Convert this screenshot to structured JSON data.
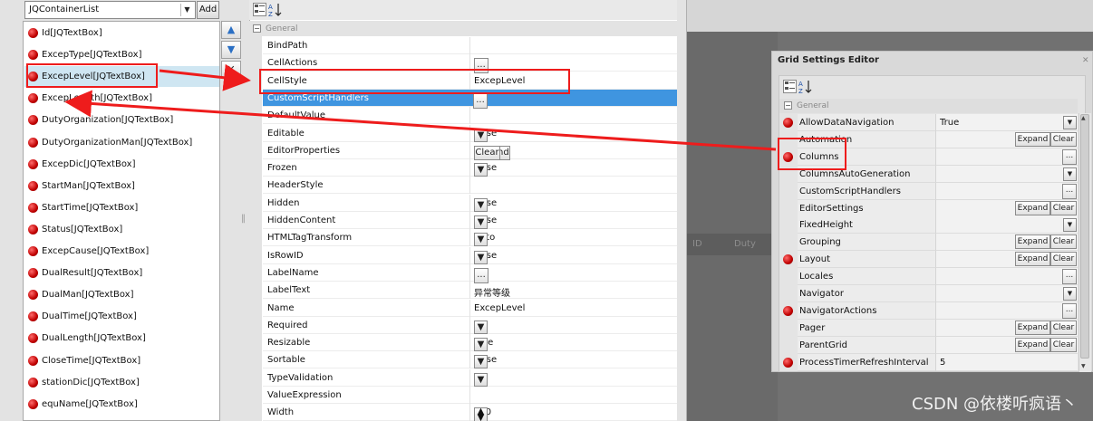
{
  "combo": {
    "value": "JQContainerList",
    "add_label": "Add"
  },
  "list_items": [
    "Id[JQTextBox]",
    "ExcepType[JQTextBox]",
    "ExcepLevel[JQTextBox]",
    "ExcepLength[JQTextBox]",
    "DutyOrganization[JQTextBox]",
    "DutyOrganizationMan[JQTextBox]",
    "ExcepDic[JQTextBox]",
    "StartMan[JQTextBox]",
    "StartTime[JQTextBox]",
    "Status[JQTextBox]",
    "ExcepCause[JQTextBox]",
    "DualResult[JQTextBox]",
    "DualMan[JQTextBox]",
    "DualTime[JQTextBox]",
    "DualLength[JQTextBox]",
    "CloseTime[JQTextBox]",
    "stationDic[JQTextBox]",
    "equName[JQTextBox]"
  ],
  "side_buttons": {
    "up": "▲",
    "down": "▼",
    "delete": "✕"
  },
  "property_grid": {
    "toolbar": {
      "categorized_icon": "categorized-icon",
      "sort_icon": "sort-az-icon",
      "az": "A\nZ"
    },
    "category": "General",
    "expand_glyph": "−",
    "dropdown_glyph": "▼",
    "ellipsis": "...",
    "expand_label": "Expand",
    "clear_label": "Clear",
    "rows": [
      {
        "name": "BindPath",
        "value": "",
        "editor": ""
      },
      {
        "name": "CellActions",
        "value": "",
        "editor": "ellipsis"
      },
      {
        "name": "CellStyle",
        "value": "ExcepLevel",
        "editor": ""
      },
      {
        "name": "CustomScriptHandlers",
        "value": "",
        "editor": "ellipsis",
        "selected": true
      },
      {
        "name": "DefaultValue",
        "value": "",
        "editor": ""
      },
      {
        "name": "Editable",
        "value": "False",
        "editor": "dropdown"
      },
      {
        "name": "EditorProperties",
        "value": "",
        "editor": "expandclear"
      },
      {
        "name": "Frozen",
        "value": "False",
        "editor": "dropdown"
      },
      {
        "name": "HeaderStyle",
        "value": "",
        "editor": ""
      },
      {
        "name": "Hidden",
        "value": "False",
        "editor": "dropdown"
      },
      {
        "name": "HiddenContent",
        "value": "False",
        "editor": "dropdown"
      },
      {
        "name": "HTMLTagTransform",
        "value": "Auto",
        "editor": "dropdown"
      },
      {
        "name": "IsRowID",
        "value": "False",
        "editor": "dropdown"
      },
      {
        "name": "LabelName",
        "value": "",
        "editor": "ellipsis"
      },
      {
        "name": "LabelText",
        "value": "异常等级",
        "editor": ""
      },
      {
        "name": "Name",
        "value": "ExcepLevel",
        "editor": ""
      },
      {
        "name": "Required",
        "value": "",
        "editor": "dropdown"
      },
      {
        "name": "Resizable",
        "value": "True",
        "editor": "dropdown"
      },
      {
        "name": "Sortable",
        "value": "False",
        "editor": "dropdown"
      },
      {
        "name": "TypeValidation",
        "value": "",
        "editor": "dropdown"
      },
      {
        "name": "ValueExpression",
        "value": "",
        "editor": ""
      },
      {
        "name": "Width",
        "value": "150",
        "editor": "spin"
      }
    ]
  },
  "grid_settings": {
    "title": "Grid Settings Editor",
    "close_glyph": "✕",
    "category": "General",
    "rows": [
      {
        "name": "AllowDataNavigation",
        "value": "True",
        "editor": "dropdown",
        "dot": true
      },
      {
        "name": "Automation",
        "value": "",
        "editor": "expandclear",
        "dot": false
      },
      {
        "name": "Columns",
        "value": "",
        "editor": "ellipsis",
        "dot": true
      },
      {
        "name": "ColumnsAutoGeneration",
        "value": "",
        "editor": "dropdown",
        "dot": false
      },
      {
        "name": "CustomScriptHandlers",
        "value": "",
        "editor": "ellipsis",
        "dot": false
      },
      {
        "name": "EditorSettings",
        "value": "",
        "editor": "expandclear",
        "dot": false
      },
      {
        "name": "FixedHeight",
        "value": "",
        "editor": "dropdown",
        "dot": false
      },
      {
        "name": "Grouping",
        "value": "",
        "editor": "expandclear",
        "dot": false
      },
      {
        "name": "Layout",
        "value": "",
        "editor": "expandclear",
        "dot": true
      },
      {
        "name": "Locales",
        "value": "",
        "editor": "ellipsis",
        "dot": false
      },
      {
        "name": "Navigator",
        "value": "",
        "editor": "dropdown",
        "dot": false
      },
      {
        "name": "NavigatorActions",
        "value": "",
        "editor": "ellipsis",
        "dot": true
      },
      {
        "name": "Pager",
        "value": "",
        "editor": "expandclear",
        "dot": false
      },
      {
        "name": "ParentGrid",
        "value": "",
        "editor": "expandclear",
        "dot": false
      },
      {
        "name": "ProcessTimerRefreshInterval",
        "value": "5",
        "editor": "",
        "dot": true
      }
    ]
  },
  "background_grid_headers": [
    "ID",
    "Duty"
  ],
  "watermark": "CSDN @依楼听疯语丶",
  "colors": {
    "annotation_red": "#ee1c1c",
    "selection_blue": "#3f95e0",
    "selected_item": "#cfe6f2"
  }
}
